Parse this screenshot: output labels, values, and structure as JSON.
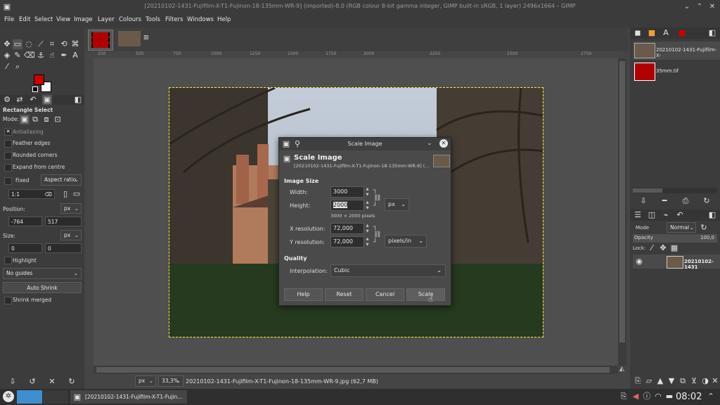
{
  "window": {
    "title": "[20210102-1431-Fujifilm-X-T1-Fujinon-18-135mm-WR-9] (imported)-8.0 (RGB colour 8-bit gamma integer, GIMP built-in sRGB, 1 layer) 2496x1664 – GIMP"
  },
  "menu": {
    "items": [
      "File",
      "Edit",
      "Select",
      "View",
      "Image",
      "Layer",
      "Colours",
      "Tools",
      "Filters",
      "Windows",
      "Help"
    ]
  },
  "tool_options": {
    "title": "Rectangle Select",
    "mode_label": "Mode:",
    "antialiasing": "Antialiasing",
    "feather_edges": "Feather edges",
    "rounded_corners": "Rounded corners",
    "expand_from_centre": "Expand from centre",
    "fixed_label": "Fixed",
    "aspect_ratio": "Aspect ratio",
    "ratio_value": "1:1",
    "position_label": "Position:",
    "position_unit": "px",
    "pos_x": "-764",
    "pos_y": "517",
    "size_label": "Size:",
    "size_unit": "px",
    "size_w": "0",
    "size_h": "0",
    "highlight": "Highlight",
    "guides": "No guides",
    "auto_shrink": "Auto Shrink",
    "shrink_merged": "Shrink merged"
  },
  "ruler": {
    "ticks": [
      "250",
      "500",
      "750",
      "1000",
      "1250",
      "1500",
      "1750",
      "2000",
      "2250",
      "2500",
      "2750"
    ]
  },
  "dialog": {
    "window_title": "Scale Image",
    "heading": "Scale Image",
    "subheading": "[20210102-1431-Fujifilm-X-T1-Fujinon-18-135mm-WR-9] (...",
    "image_size_label": "Image Size",
    "width_label": "Width:",
    "width_value": "3000",
    "height_label": "Height:",
    "height_value": "2000",
    "size_note": "3000 × 2000 pixels",
    "unit": "px",
    "xres_label": "X resolution:",
    "xres_value": "72,000",
    "yres_label": "Y resolution:",
    "yres_value": "72,000",
    "res_unit": "pixels/in",
    "quality_label": "Quality",
    "interp_label": "Interpolation:",
    "interp_value": "Cubic",
    "help": "Help",
    "reset": "Reset",
    "cancel": "Cancel",
    "scale": "Scale"
  },
  "images_panel": {
    "items": [
      {
        "name": "20210102-1431-Fujifilm-X-"
      },
      {
        "name": "35mm.tif"
      }
    ]
  },
  "layers": {
    "mode_label": "Mode",
    "mode_value": "Normal",
    "opacity_label": "Opacity",
    "opacity_value": "100,0",
    "lock_label": "Lock:",
    "layer_name": "20210102-1431"
  },
  "status": {
    "unit": "px",
    "zoom": "33,3%",
    "file": "20210102-1431-Fujifilm-X-T1-Fujinon-18-135mm-WR-9.jpg (62,7 MB)"
  },
  "taskbar": {
    "task": "[20210102-1431-Fujifilm-X-T1-Fujin...",
    "clock": "08:02"
  },
  "colors": {
    "fg": "#cc0000",
    "bg": "#ffffff"
  }
}
